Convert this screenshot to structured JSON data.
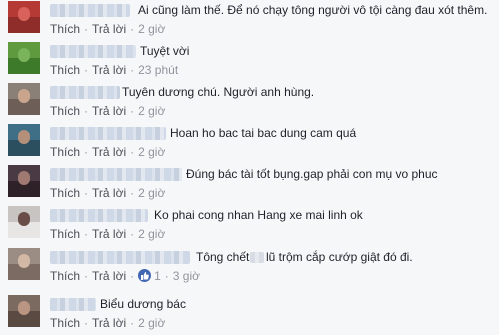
{
  "actions": {
    "like": "Thích",
    "reply": "Trả lời",
    "separator": "·"
  },
  "comments": [
    {
      "text": "Ai cũng làm thế. Để nó chạy tông người vô tội càng đau xót thêm.",
      "time": "2 giờ"
    },
    {
      "text": "Tuyệt vời",
      "time": "23 phút"
    },
    {
      "text": "Tuyên dương chú. Người anh hùng.",
      "time": "2 giờ"
    },
    {
      "text": "Hoan ho bac tai bac dung cam quá",
      "time": "2 giờ"
    },
    {
      "text": "Đúng bác tài tốt bụng.gap phải con mụ vo phuc",
      "time": "2 giờ"
    },
    {
      "text": "Ko phai cong nhan Hang xe mai linh ok",
      "time": "2 giờ"
    },
    {
      "text_before": "Tông chết",
      "text_after": "lũ trộm cắp cướp giật đó đi.",
      "likes": "1",
      "time": "3 giờ"
    },
    {
      "text": "Biểu dương bác",
      "time": "2 giờ"
    }
  ],
  "colors": {
    "background": "#f6f7f9",
    "text": "#1d2129",
    "action_link": "#4b4f56",
    "timestamp": "#90949c",
    "like_badge": "#4267b2"
  },
  "icons": {
    "like_badge": "thumbs-up-icon"
  }
}
